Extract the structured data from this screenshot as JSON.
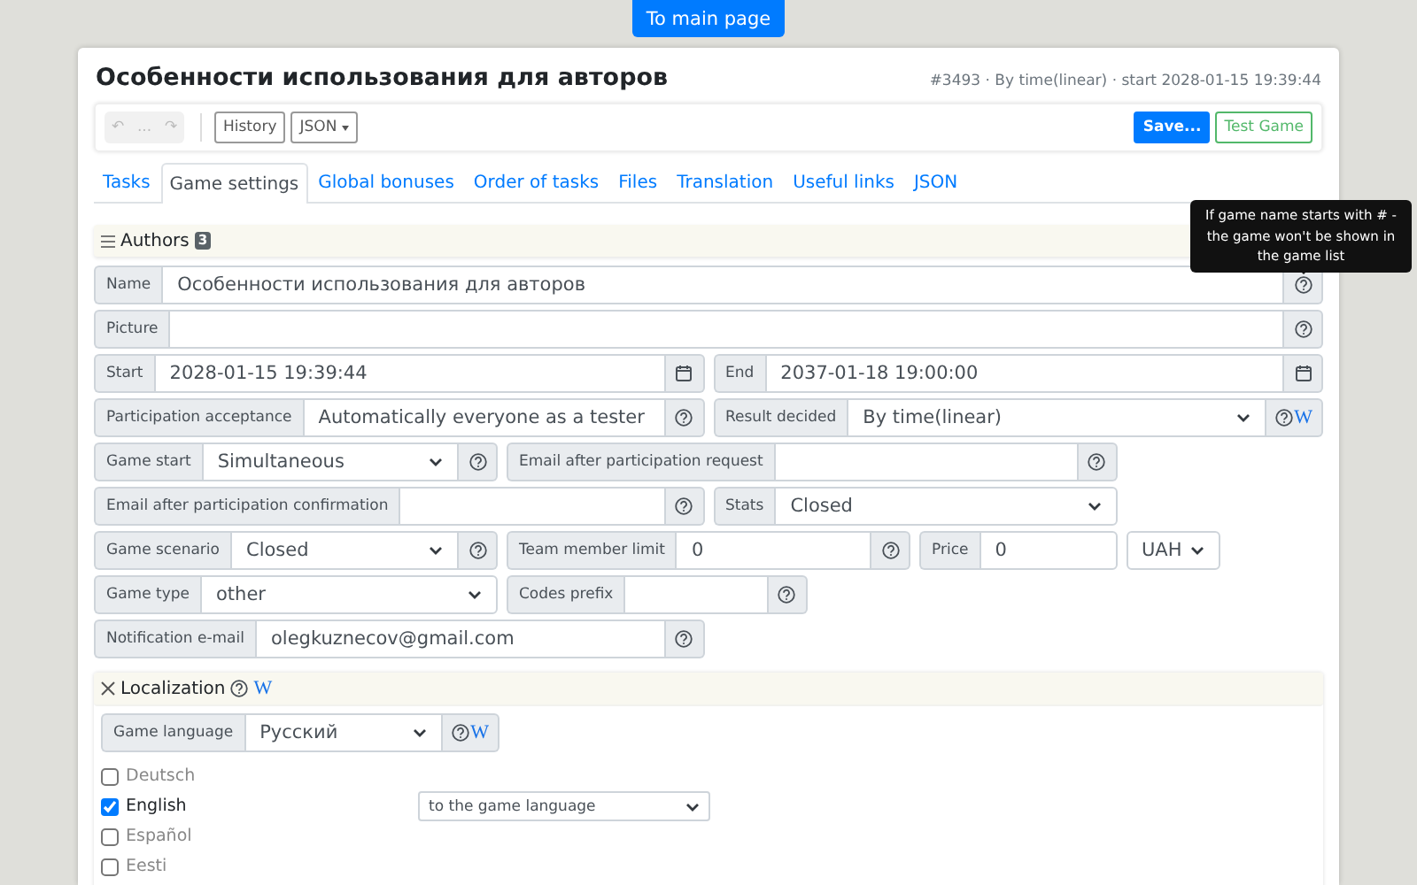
{
  "top_button": "To main page",
  "title": "Особенности использования для авторов",
  "meta": "#3493 · By time(linear) · start 2028-01-15 19:39:44",
  "toolbar": {
    "history": [
      {
        "label": "↶",
        "disabled": true
      },
      {
        "label": "...",
        "disabled": true
      },
      {
        "label": "↷",
        "disabled": true
      }
    ],
    "buttons": [
      {
        "label": "History",
        "kind": "plain"
      },
      {
        "label": "JSON",
        "kind": "dropdown"
      }
    ],
    "actions": [
      {
        "label": "Save...",
        "kind": "primary"
      },
      {
        "label": "Test Game",
        "kind": "outline"
      }
    ]
  },
  "tabs": [
    {
      "label": "Tasks",
      "selected": false
    },
    {
      "label": "Game settings",
      "selected": true
    },
    {
      "label": "Global bonuses",
      "selected": false
    },
    {
      "label": "Order of tasks",
      "selected": false
    },
    {
      "label": "Files",
      "selected": false
    },
    {
      "label": "Translation",
      "selected": false
    },
    {
      "label": "Useful links",
      "selected": false
    },
    {
      "label": "JSON",
      "selected": false
    }
  ],
  "authors": {
    "label": "Authors",
    "count": "3",
    "expanded": false
  },
  "tooltip": "If game name starts with # - the game won't be shown in the game list",
  "rows": [
    [
      {
        "label": "Name",
        "kind": "input",
        "value": "Особенности использования для авторов",
        "addon": {
          "kind": "help"
        }
      }
    ],
    [
      {
        "label": "Picture",
        "kind": "input",
        "addon": {
          "kind": "help"
        }
      }
    ],
    [
      {
        "label": "Start",
        "kind": "input",
        "value": "2028-01-15 19:39:44",
        "addon": {
          "kind": "calendar"
        }
      },
      {
        "label": "End",
        "kind": "input",
        "value": "2037-01-18 19:00:00",
        "addon": {
          "kind": "calendar"
        }
      }
    ],
    [
      {
        "label": "Participation acceptance",
        "kind": "select",
        "value": "Automatically everyone as a tester",
        "addon": {
          "kind": "help"
        }
      },
      {
        "label": "Result decided",
        "kind": "select",
        "value": "By time(linear)",
        "addon": {
          "kind": "help-wiki",
          "link": "W"
        }
      }
    ],
    [
      {
        "label": "Game start",
        "kind": "select",
        "value": "Simultaneous",
        "addon": {
          "kind": "help"
        }
      },
      {
        "label": "Email after participation request",
        "kind": "input",
        "addon": {
          "kind": "help"
        }
      }
    ],
    [
      {
        "label": "Email after participation confirmation",
        "kind": "input",
        "addon": {
          "kind": "help"
        }
      },
      {
        "label": "Stats",
        "kind": "select",
        "value": "Closed"
      }
    ],
    [
      {
        "label": "Game scenario",
        "kind": "select",
        "value": "Closed",
        "addon": {
          "kind": "help"
        }
      },
      {
        "label": "Team member limit",
        "kind": "input",
        "value": "0",
        "addon": {
          "kind": "help"
        }
      },
      {
        "label": "Price",
        "kind": "input",
        "value": "0"
      },
      {
        "kind": "select",
        "value": "UAH"
      }
    ],
    [
      {
        "label": "Game type",
        "kind": "select",
        "value": "other"
      },
      {
        "label": "Codes prefix",
        "kind": "input",
        "addon": {
          "kind": "help"
        }
      }
    ],
    [
      {
        "label": "Notification e-mail",
        "kind": "input",
        "value": "olegkuznecov@gmail.com",
        "addon": {
          "kind": "help"
        }
      }
    ]
  ],
  "localization": {
    "title": "Localization",
    "expanded": true,
    "wiki": "W",
    "language": {
      "label": "Game language",
      "value": "Русский",
      "addon": {
        "kind": "help-wiki",
        "link": "W"
      }
    },
    "languages": [
      {
        "name": "Deutsch",
        "checked": false
      },
      {
        "name": "English",
        "checked": true,
        "direction": "to the game language"
      },
      {
        "name": "Español",
        "checked": false
      },
      {
        "name": "Eesti",
        "checked": false
      }
    ]
  }
}
